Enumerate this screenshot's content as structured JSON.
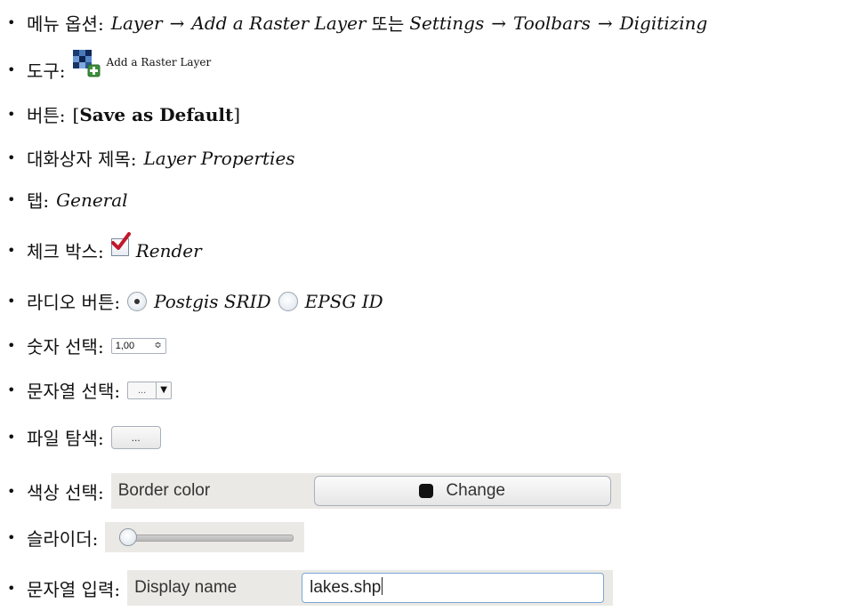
{
  "items": [
    {
      "label": "메뉴 옵션:",
      "parts": [
        "Layer",
        "→",
        "Add a Raster Layer",
        "또는",
        "Settings",
        "→",
        "Toolbars",
        "→",
        "Digitizing"
      ]
    },
    {
      "label": "도구:",
      "icon": "raster-layer-add-icon",
      "text": "Add a Raster Layer"
    },
    {
      "label": "버튼:",
      "bracket_open": "[",
      "bold": "Save as Default",
      "bracket_close": "]"
    },
    {
      "label": "대화상자 제목:",
      "text": "Layer Properties"
    },
    {
      "label": "탭:",
      "text": "General"
    },
    {
      "label": "체크 박스:",
      "text": "Render",
      "checked": true
    },
    {
      "label": "라디오 버튼:",
      "options": [
        {
          "text": "Postgis SRID",
          "selected": true
        },
        {
          "text": "EPSG ID",
          "selected": false
        }
      ]
    },
    {
      "label": "숫자 선택:",
      "value": "1,00",
      "arrows": "≎"
    },
    {
      "label": "문자열 선택:",
      "value": "...",
      "arrow": "▼"
    },
    {
      "label": "파일 탐색:",
      "button": "..."
    },
    {
      "label": "색상 선택:",
      "field_label": "Border color",
      "button": "Change",
      "swatch_color": "#111111"
    },
    {
      "label": "슬라이더:",
      "value": 0.05
    },
    {
      "label": "문자열 입력:",
      "field_label": "Display name",
      "value": "lakes.shp"
    }
  ],
  "bullet": "•"
}
